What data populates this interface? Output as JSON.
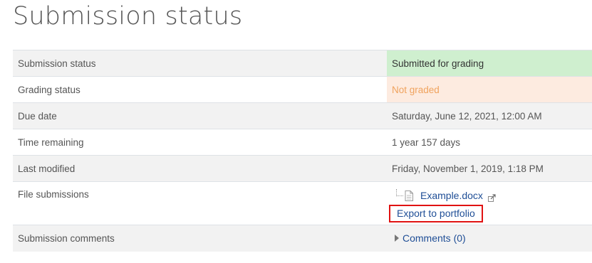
{
  "page": {
    "title": "Submission status"
  },
  "rows": [
    {
      "label": "Submission status",
      "value": "Submitted for grading"
    },
    {
      "label": "Grading status",
      "value": "Not graded"
    },
    {
      "label": "Due date",
      "value": "Saturday, June 12, 2021, 12:00 AM"
    },
    {
      "label": "Time remaining",
      "value": "1 year 157 days"
    },
    {
      "label": "Last modified",
      "value": "Friday, November 1, 2019, 1:18 PM"
    }
  ],
  "files": {
    "label": "File submissions",
    "file_name": "Example.docx",
    "file_icon": "document-icon",
    "portfolio_icon": "portfolio-export-icon",
    "export_label": "Export to portfolio"
  },
  "comments": {
    "label": "Submission comments",
    "link_label": "Comments (0)",
    "toggle_icon": "caret-right-icon"
  },
  "colors": {
    "submitted_bg": "#cfefcf",
    "notgraded_bg": "#fdebe0",
    "notgraded_text": "#f0a35e",
    "link": "#1f4e96",
    "highlight_border": "#e01212"
  }
}
